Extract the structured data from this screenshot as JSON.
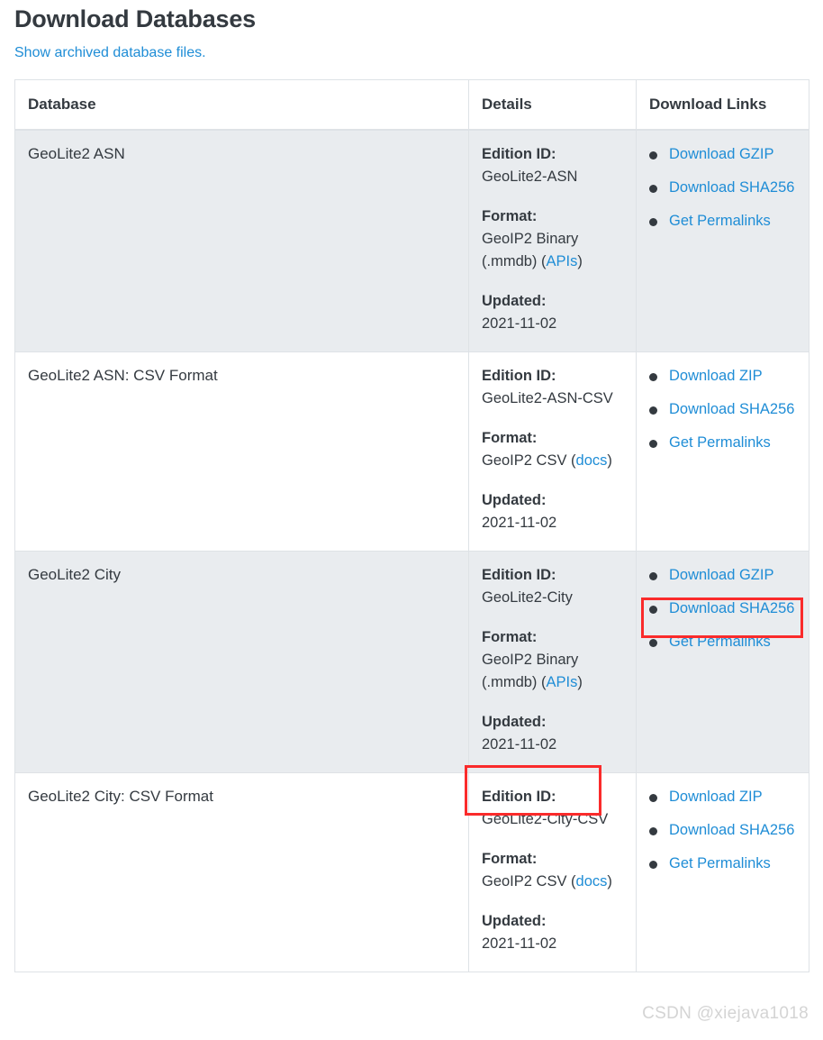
{
  "header": {
    "title": "Download Databases",
    "archived_link": "Show archived database files."
  },
  "table": {
    "columns": [
      "Database",
      "Details",
      "Download Links"
    ],
    "labels": {
      "edition_id": "Edition ID:",
      "format": "Format:",
      "updated": "Updated:"
    },
    "rows": [
      {
        "name": "GeoLite2 ASN",
        "edition_id": "GeoLite2-ASN",
        "format_text": "GeoIP2 Binary (.mmdb) (",
        "format_link": "APIs",
        "format_suffix": ")",
        "updated": "2021-11-02",
        "links": [
          "Download GZIP",
          "Download SHA256",
          "Get Permalinks"
        ]
      },
      {
        "name": "GeoLite2 ASN: CSV Format",
        "edition_id": "GeoLite2-ASN-CSV",
        "format_text": "GeoIP2 CSV (",
        "format_link": "docs",
        "format_suffix": ")",
        "updated": "2021-11-02",
        "links": [
          "Download ZIP",
          "Download SHA256",
          "Get Permalinks"
        ]
      },
      {
        "name": "GeoLite2 City",
        "edition_id": "GeoLite2-City",
        "format_text": "GeoIP2 Binary (.mmdb) (",
        "format_link": "APIs",
        "format_suffix": ")",
        "updated": "2021-11-02",
        "links": [
          "Download GZIP",
          "Download SHA256",
          "Get Permalinks"
        ]
      },
      {
        "name": "GeoLite2 City: CSV Format",
        "edition_id": "GeoLite2-City-CSV",
        "format_text": "GeoIP2 CSV (",
        "format_link": "docs",
        "format_suffix": ")",
        "updated": "2021-11-02",
        "links": [
          "Download ZIP",
          "Download SHA256",
          "Get Permalinks"
        ]
      }
    ]
  },
  "annotations": {
    "highlight_download_gzip": "Download GZIP",
    "highlight_updated": "Updated: 2021-11-02"
  },
  "watermark": "CSDN @xiejava1018",
  "colors": {
    "link": "#1f8dd6",
    "text": "#343a40",
    "row_alt_bg": "#e9ecef",
    "border": "#dee2e6",
    "highlight": "#fa2b2b",
    "bullet": "#343a40"
  }
}
